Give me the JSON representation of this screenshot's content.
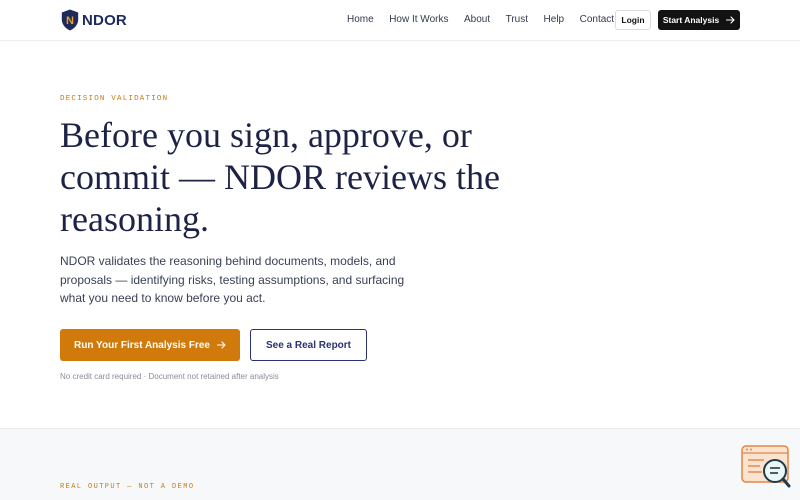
{
  "brand": {
    "name": "NDOR",
    "shield_letter": "N"
  },
  "nav": {
    "items": [
      "Home",
      "How It Works",
      "About",
      "Trust",
      "Help",
      "Contact"
    ],
    "login_label": "Login",
    "start_label": "Start Analysis"
  },
  "hero": {
    "eyebrow": "DECISION VALIDATION",
    "headline_line1": "Before you sign, approve, or",
    "headline_line2": "commit — NDOR reviews the",
    "headline_line3": "reasoning.",
    "subtext": "NDOR validates the reasoning behind documents, models, and proposals — identifying risks, testing assumptions, and surfacing what you need to know before you act.",
    "primary_cta": "Run Your First Analysis Free",
    "secondary_cta": "See a Real Report",
    "fineprint": "No credit card required · Document not retained after analysis"
  },
  "section2": {
    "eyebrow": "REAL OUTPUT — NOT A DEMO"
  },
  "colors": {
    "accent": "#d07a0c",
    "navy": "#1d2347",
    "dark_button": "#121212"
  },
  "icons": {
    "logo": "shield-logo-icon",
    "arrow": "arrow-right-icon",
    "chat": "chat-search-icon"
  }
}
